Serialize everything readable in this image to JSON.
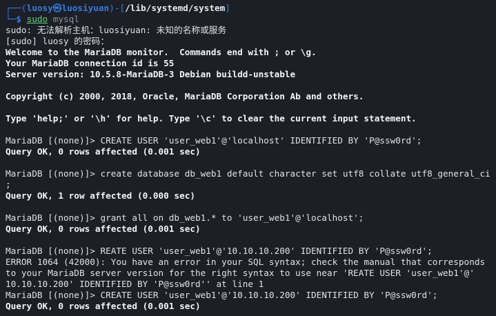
{
  "prompt": {
    "corner_top": "┌──(",
    "user": "luosy",
    "at_symbol": "㉿",
    "host": "luosiyuan",
    "bracket_mid": ")-[",
    "path": "/lib/systemd/system",
    "bracket_end": "]",
    "corner_bottom": "└─",
    "dollar": "$",
    "command": "sudo",
    "command_arg": "mysql"
  },
  "output_lines": [
    {
      "text": "sudo: 无法解析主机：luosiyuan: 未知的名称或服务",
      "bold": false
    },
    {
      "text": "[sudo] luosy 的密码：",
      "bold": false
    },
    {
      "text": "Welcome to the MariaDB monitor.  Commands end with ; or \\g.",
      "bold": true
    },
    {
      "text": "Your MariaDB connection id is 55",
      "bold": true
    },
    {
      "text": "Server version: 10.5.8-MariaDB-3 Debian buildd-unstable",
      "bold": true
    },
    {
      "text": "",
      "bold": false
    },
    {
      "text": "Copyright (c) 2000, 2018, Oracle, MariaDB Corporation Ab and others.",
      "bold": true
    },
    {
      "text": "",
      "bold": false
    },
    {
      "text": "Type 'help;' or '\\h' for help. Type '\\c' to clear the current input statement.",
      "bold": true
    },
    {
      "text": "",
      "bold": false
    },
    {
      "text": "MariaDB [(none)]> CREATE USER 'user_web1'@'localhost' IDENTIFIED BY 'P@ssw0rd';",
      "bold": false
    },
    {
      "text": "Query OK, 0 rows affected (0.001 sec)",
      "bold": true
    },
    {
      "text": "",
      "bold": false
    },
    {
      "text": "MariaDB [(none)]> create database db_web1 default character set utf8 collate utf8_general_ci",
      "bold": false
    },
    {
      "text": ";",
      "bold": false
    },
    {
      "text": "Query OK, 1 row affected (0.000 sec)",
      "bold": true
    },
    {
      "text": "",
      "bold": false
    },
    {
      "text": "MariaDB [(none)]> grant all on db_web1.* to 'user_web1'@'localhost';",
      "bold": false
    },
    {
      "text": "Query OK, 0 rows affected (0.001 sec)",
      "bold": true
    },
    {
      "text": "",
      "bold": false
    },
    {
      "text": "MariaDB [(none)]> REATE USER 'user_web1'@'10.10.10.200' IDENTIFIED BY 'P@ssw0rd';",
      "bold": false
    },
    {
      "text": "ERROR 1064 (42000): You have an error in your SQL syntax; check the manual that corresponds",
      "bold": false
    },
    {
      "text": "to your MariaDB server version for the right syntax to use near 'REATE USER 'user_web1'@'",
      "bold": false
    },
    {
      "text": "10.10.10.200' IDENTIFIED BY 'P@ssw0rd'' at line 1",
      "bold": false
    },
    {
      "text": "MariaDB [(none)]> CREATE USER 'user_web1'@'10.10.10.200' IDENTIFIED BY 'P@ssw0rd';",
      "bold": false
    },
    {
      "text": "Query OK, 0 rows affected (0.001 sec)",
      "bold": true
    }
  ]
}
